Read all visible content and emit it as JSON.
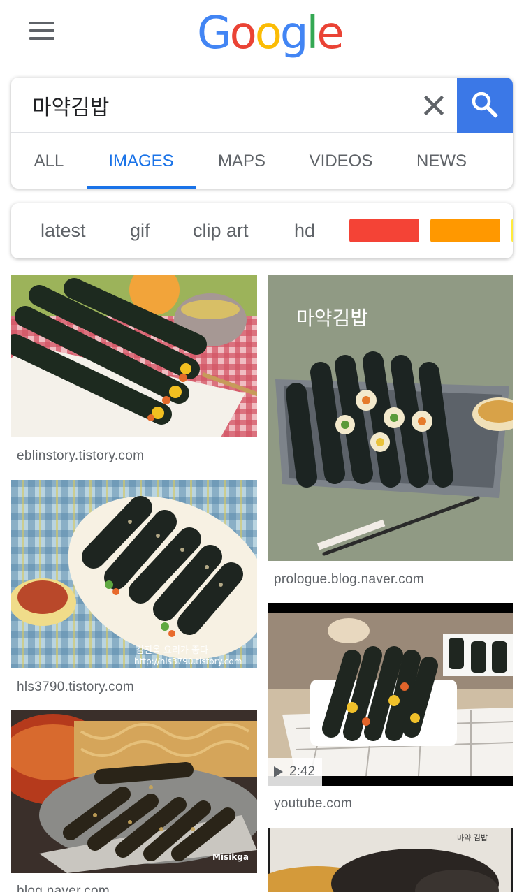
{
  "header": {
    "logo": [
      "G",
      "o",
      "o",
      "g",
      "l",
      "e"
    ],
    "logo_colors": [
      "#4285F4",
      "#EA4335",
      "#FBBC05",
      "#4285F4",
      "#34A853",
      "#EA4335"
    ]
  },
  "search": {
    "query": "마약김밥",
    "button_color": "#3b78e7"
  },
  "tabs": [
    {
      "label": "ALL",
      "active": false
    },
    {
      "label": "IMAGES",
      "active": true
    },
    {
      "label": "MAPS",
      "active": false
    },
    {
      "label": "VIDEOS",
      "active": false
    },
    {
      "label": "NEWS",
      "active": false
    }
  ],
  "chips": {
    "labels": [
      "latest",
      "gif",
      "clip art",
      "hd"
    ],
    "colors": [
      "#f44336",
      "#ff9800",
      "#ffeb3b"
    ]
  },
  "results": [
    {
      "source": "eblinstory.tistory.com"
    },
    {
      "source": "hls3790.tistory.com",
      "watermark": "김진옥 요리가 좋다",
      "watermark_url": "http://hls3790.tistory.com"
    },
    {
      "source": "blog.naver.com",
      "watermark": "Misikga"
    },
    {
      "source": "prologue.blog.naver.com",
      "watermark": "마약김밥"
    },
    {
      "source": "youtube.com",
      "duration": "2:42"
    },
    {
      "source": "",
      "watermark": "마약 김밥"
    }
  ]
}
